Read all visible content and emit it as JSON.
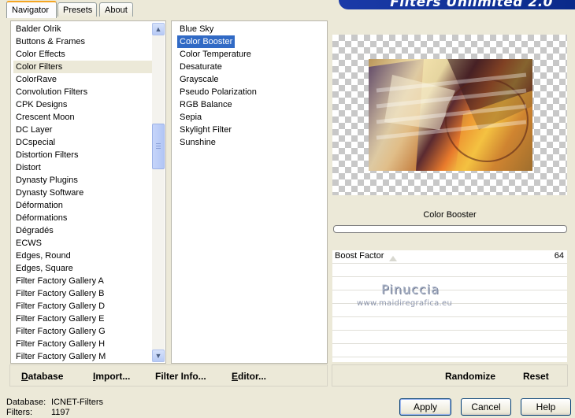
{
  "tabs": [
    {
      "label": "Navigator",
      "active": true
    },
    {
      "label": "Presets",
      "active": false
    },
    {
      "label": "About",
      "active": false
    }
  ],
  "banner": {
    "title": "Filters Unlimited 2.0"
  },
  "categories": {
    "items": [
      "Balder Olrik",
      "Buttons & Frames",
      "Color Effects",
      "Color Filters",
      "ColorRave",
      "Convolution Filters",
      "CPK Designs",
      "Crescent Moon",
      "DC Layer",
      "DCspecial",
      "Distortion Filters",
      "Distort",
      "Dynasty Plugins",
      "Dynasty Software",
      "Déformation",
      "Déformations",
      "Dégradés",
      "ECWS",
      "Edges, Round",
      "Edges, Square",
      "Filter Factory Gallery A",
      "Filter Factory Gallery B",
      "Filter Factory Gallery D",
      "Filter Factory Gallery E",
      "Filter Factory Gallery G",
      "Filter Factory Gallery H",
      "Filter Factory Gallery M"
    ],
    "selected_index": 3
  },
  "filters": {
    "items": [
      "Blue Sky",
      "Color Booster",
      "Color Temperature",
      "Desaturate",
      "Grayscale",
      "Pseudo Polarization",
      "RGB Balance",
      "Sepia",
      "Skylight Filter",
      "Sunshine"
    ],
    "selected_index": 1
  },
  "filter_title": "Color Booster",
  "params": [
    {
      "label": "Boost Factor",
      "value": "64"
    }
  ],
  "watermark": {
    "line1": "Pinuccia",
    "line2": "www.maidiregrafica.eu"
  },
  "left_buttons": [
    {
      "label": "Database",
      "underline": "D",
      "rest": "atabase"
    },
    {
      "label": "Import...",
      "underline": "I",
      "rest": "mport..."
    },
    {
      "label": "Filter Info...",
      "underline": "",
      "rest": "Filter Info..."
    },
    {
      "label": "Editor...",
      "underline": "E",
      "rest": "ditor..."
    }
  ],
  "right_buttons": {
    "randomize": "Randomize",
    "reset": "Reset"
  },
  "status": {
    "database_label": "Database:",
    "database_value": "ICNET-Filters",
    "filters_label": "Filters:",
    "filters_value": "1197"
  },
  "dialog_buttons": {
    "apply": "Apply",
    "cancel": "Cancel",
    "help": "Help"
  },
  "colors": {
    "selection": "#316ac5",
    "banner": "#1a3aa8",
    "background": "#ece9d8"
  }
}
